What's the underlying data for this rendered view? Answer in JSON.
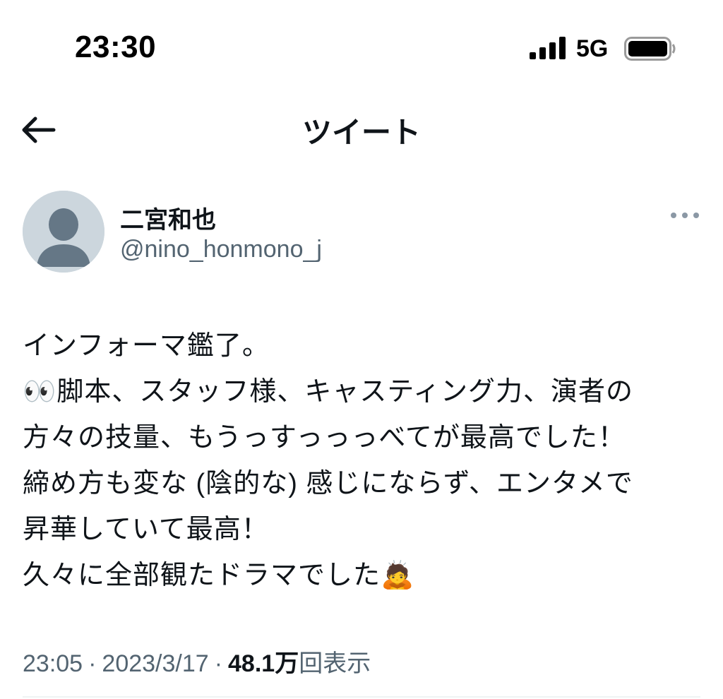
{
  "status_bar": {
    "time": "23:30",
    "network": "5G",
    "icons": [
      "signal-bars-icon",
      "battery-icon"
    ]
  },
  "header": {
    "title": "ツイート",
    "back_icon": "arrow-left-icon"
  },
  "author": {
    "name": "二宮和也",
    "handle": "@nino_honmono_j",
    "avatar_icon": "default-avatar-icon",
    "more_icon": "more-horizontal-icon"
  },
  "tweet": {
    "lines": [
      "インフォーマ鑑了。",
      "👀脚本、スタッフ様、キャスティング力、演者の",
      "方々の技量、もうっすっっっべてが最高でした！",
      "締め方も変な (陰的な) 感じにならず、エンタメで",
      "昇華していて最高！",
      "久々に全部観たドラマでした🙇"
    ]
  },
  "meta": {
    "time": "23:05",
    "date": "2023/3/17",
    "separator": "·",
    "views_count": "48.1万",
    "views_label": "回表示"
  },
  "colors": {
    "text_primary": "#0f1419",
    "text_secondary": "#536471",
    "avatar_bg": "#ccd6dd",
    "avatar_fg": "#657786",
    "divider": "#eff3f4"
  }
}
